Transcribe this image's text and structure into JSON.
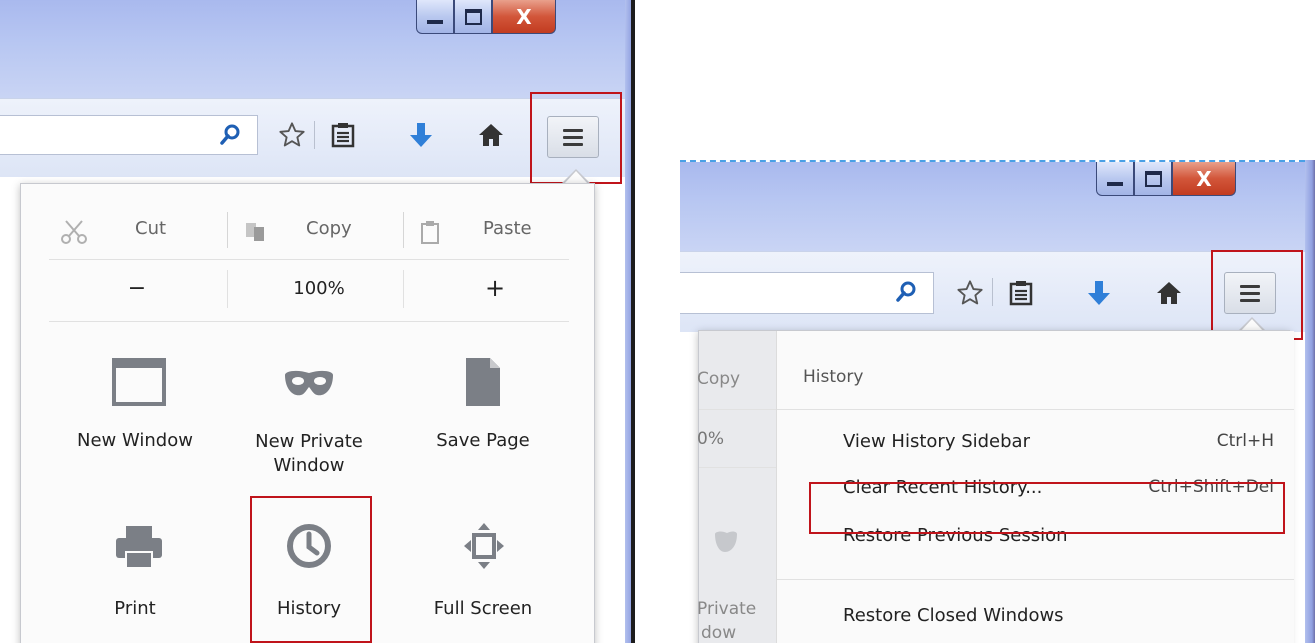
{
  "left": {
    "edit": {
      "cut": "Cut",
      "copy": "Copy",
      "paste": "Paste"
    },
    "zoom": {
      "minus": "−",
      "level": "100%",
      "plus": "+"
    },
    "grid": [
      {
        "label": "New Window",
        "icon": "window-icon"
      },
      {
        "label": "New Private Window",
        "icon": "mask-icon"
      },
      {
        "label": "Save Page",
        "icon": "page-icon"
      },
      {
        "label": "Print",
        "icon": "printer-icon"
      },
      {
        "label": "History",
        "icon": "clock-icon"
      },
      {
        "label": "Full Screen",
        "icon": "fullscreen-icon"
      }
    ]
  },
  "right": {
    "behind": {
      "copy": "Copy",
      "zoom": "0%",
      "private_line1": "Private",
      "private_line2": "dow"
    },
    "history": {
      "title": "History",
      "items": [
        {
          "label": "View History Sidebar",
          "shortcut": "Ctrl+H"
        },
        {
          "label": "Clear Recent History...",
          "shortcut": "Ctrl+Shift+Del"
        },
        {
          "label": "Restore Previous Session",
          "shortcut": ""
        },
        {
          "label": "Restore Closed Windows",
          "shortcut": ""
        }
      ]
    }
  },
  "window_controls": {
    "close": "X"
  },
  "colors": {
    "highlight": "#c0141b",
    "download_arrow": "#2f7fd8",
    "icon_gray": "#7b7f86"
  }
}
